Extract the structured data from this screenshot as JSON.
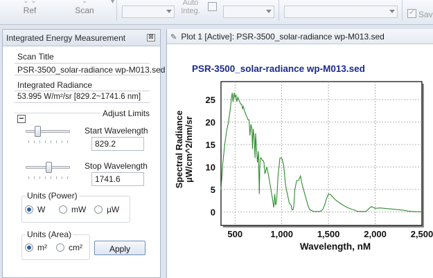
{
  "toolbar": {
    "ref_label": "Ref",
    "scan_label": "Scan",
    "auto_integ_line1": "Auto",
    "auto_integ_line2": "Integ.",
    "save_label": "Save"
  },
  "left_panel": {
    "title": "Integrated Energy Measurement",
    "scan_title_label": "Scan Title",
    "scan_title_value": "PSR-3500_solar-radiance wp-M013.sed",
    "integrated_radiance_label": "Integrated Radiance",
    "integrated_radiance_value": "53.995 W/m²/sr [829.2~1741.6 nm]",
    "adjust_limits_label": "Adjust Limits",
    "collapse_symbol": "−",
    "start_wavelength_label": "Start Wavelength",
    "start_wavelength_value": "829.2",
    "stop_wavelength_label": "Stop Wavelength",
    "stop_wavelength_value": "1741.6",
    "units_power": {
      "label": "Units (Power)",
      "options": [
        "W",
        "mW",
        "µW"
      ],
      "selected": "W"
    },
    "units_area": {
      "label": "Units (Area)",
      "options": [
        "m²",
        "cm²"
      ],
      "selected": "m²"
    },
    "apply_label": "Apply"
  },
  "plot_panel": {
    "tab_title": "Plot 1 [Active]: PSR-3500_solar-radiance wp-M013.sed"
  },
  "chart_data": {
    "type": "line",
    "title": "PSR-3500_solar-radiance  wp-M013.sed",
    "xlabel": "Wavelength, nM",
    "ylabel_line1": "Spectral Radiance",
    "ylabel_line2": "µW/cm^2/nm/sr",
    "xlim": [
      350,
      2500
    ],
    "ylim": [
      -3,
      29
    ],
    "x_ticks": [
      500,
      1000,
      1500,
      2000,
      2500
    ],
    "x_tick_labels": [
      "500",
      "1,000",
      "1,500",
      "2,000",
      "2,500"
    ],
    "y_ticks": [
      0,
      5,
      10,
      15,
      20,
      25
    ],
    "y_tick_labels": [
      "0",
      "5",
      "10",
      "15",
      "20",
      "25"
    ],
    "grid": true,
    "series": [
      {
        "color": "#2e8b2e",
        "x": [
          350,
          370,
          390,
          410,
          430,
          450,
          460,
          470,
          480,
          490,
          500,
          510,
          520,
          530,
          540,
          550,
          560,
          570,
          580,
          590,
          600,
          610,
          620,
          630,
          640,
          650,
          660,
          670,
          680,
          687,
          695,
          705,
          715,
          720,
          730,
          740,
          750,
          760,
          765,
          770,
          780,
          790,
          800,
          810,
          820,
          840,
          860,
          880,
          900,
          915,
          925,
          935,
          945,
          950,
          960,
          980,
          1000,
          1020,
          1040,
          1060,
          1080,
          1100,
          1110,
          1120,
          1130,
          1140,
          1160,
          1180,
          1200,
          1220,
          1240,
          1260,
          1280,
          1300,
          1320,
          1340,
          1360,
          1380,
          1400,
          1420,
          1440,
          1460,
          1480,
          1500,
          1520,
          1540,
          1560,
          1580,
          1600,
          1650,
          1700,
          1750,
          1780,
          1800,
          1820,
          1850,
          1880,
          1900,
          1920,
          1940,
          1960,
          2000,
          2050,
          2100,
          2150,
          2200,
          2250,
          2300,
          2350,
          2400,
          2450,
          2500
        ],
        "y": [
          5,
          11,
          15,
          18,
          20,
          23,
          25,
          26.5,
          24.5,
          26.5,
          25.5,
          26,
          24.5,
          25.5,
          25,
          24.5,
          24,
          24,
          23,
          23.5,
          22.5,
          22,
          21.5,
          21,
          20.5,
          20.5,
          17,
          19.5,
          18.5,
          14,
          18.5,
          16.5,
          12,
          17.5,
          14,
          11,
          13.5,
          4,
          10,
          12,
          12,
          11.5,
          11.5,
          11,
          8.5,
          10,
          8,
          5.5,
          3,
          1,
          4,
          1.5,
          2.5,
          4,
          8,
          12,
          12,
          10.5,
          6,
          4,
          2,
          1.5,
          0.5,
          0.5,
          1.5,
          5,
          7,
          7,
          8,
          6,
          4.5,
          3,
          1.5,
          0.5,
          0.3,
          0.1,
          0.1,
          0.1,
          0.1,
          0.2,
          0.6,
          1.6,
          3,
          4,
          3.9,
          3.5,
          3,
          2.6,
          2.3,
          1.6,
          1.0,
          0.6,
          0.4,
          0.2,
          0.1,
          0.1,
          0.1,
          0.1,
          0.5,
          0.9,
          1.2,
          0.8,
          0.9,
          0.8,
          0.7,
          0.6,
          0.5,
          0.4,
          0.2,
          0.1,
          0.05,
          0.05
        ]
      }
    ]
  }
}
